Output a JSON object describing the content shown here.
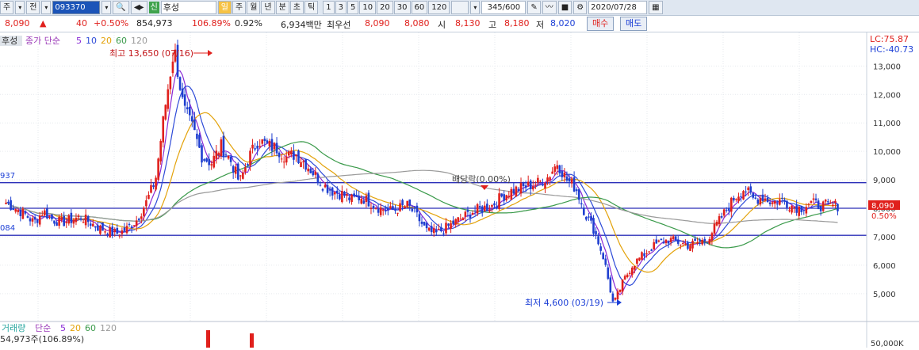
{
  "toolbar": {
    "market": "주",
    "mode": "전",
    "code": "093370",
    "name": "후성",
    "shin": "신",
    "periods": [
      "일",
      "주",
      "월",
      "년",
      "분",
      "초",
      "틱"
    ],
    "selected_period": "일",
    "intervals": [
      "1",
      "3",
      "5",
      "10",
      "20",
      "30",
      "60",
      "120"
    ],
    "count": "345/600",
    "date": "2020/07/28"
  },
  "quote": {
    "price": "8,090",
    "arrow": "▲",
    "change": "40",
    "change_pct": "+0.50%",
    "volume": "854,973",
    "vol_ratio": "106.89%",
    "turnover": "0.92%",
    "amount": "6,934백만",
    "best_label": "최우선",
    "best_ask": "8,090",
    "best_bid": "8,080",
    "open_label": "시",
    "open": "8,130",
    "high_label": "고",
    "high": "8,180",
    "low_label": "저",
    "low": "8,020",
    "buy_label": "매수",
    "sell_label": "매도"
  },
  "legend": {
    "name": "후성",
    "price_label": "종가 단순",
    "ma_periods": [
      "5",
      "10",
      "20",
      "60",
      "120"
    ],
    "ma_colors": [
      "#8a2bd6",
      "#2e4bd8",
      "#e3a20a",
      "#3a9a4a",
      "#9a9a9a"
    ],
    "lc": "LC:75.87",
    "hc": "HC:-40.73",
    "left_upper": "937",
    "left_lower": "084"
  },
  "volume_legend": {
    "label": "거래량",
    "type": "단순",
    "ma_periods": [
      "5",
      "20",
      "60",
      "120"
    ],
    "value": "54,973주(106.89%)",
    "axis_tick": "50,000K"
  },
  "annotations": {
    "high": "최고 13,650 (07/16)",
    "low": "최저 4,600 (03/19)",
    "dividend": "배당락(0.00%)",
    "last_price": "8,090",
    "last_pct": "0.50%"
  },
  "chart_data": {
    "type": "candlestick",
    "ylim": [
      4300,
      13900
    ],
    "yticks": [
      "13,000",
      "12,000",
      "11,000",
      "10,000",
      "9,000",
      "8,000",
      "7,000",
      "6,000",
      "5,000"
    ],
    "ytick_values": [
      13000,
      12000,
      11000,
      10000,
      9000,
      8000,
      7000,
      6000,
      5000
    ],
    "hlines": [
      8900,
      8000,
      7050
    ],
    "close_series": [
      8200,
      8000,
      7800,
      7500,
      7900,
      7600,
      7500,
      7600,
      7700,
      7500,
      7300,
      7200,
      7100,
      7300,
      7600,
      8200,
      9000,
      11500,
      13650,
      11500,
      10800,
      9800,
      9600,
      10200,
      9700,
      8900,
      9800,
      10400,
      10200,
      10100,
      9800,
      9900,
      9600,
      9200,
      8800,
      8600,
      8500,
      8300,
      8400,
      8200,
      8000,
      7900,
      8000,
      8100,
      7700,
      7200,
      7100,
      7300,
      7500,
      7700,
      7900,
      8000,
      8100,
      8400,
      8600,
      8700,
      8800,
      8900,
      9100,
      9600,
      9000,
      8700,
      7800,
      7200,
      6200,
      4600,
      5400,
      6000,
      6300,
      6600,
      6800,
      6900,
      6800,
      6700,
      6800,
      6900,
      7400,
      7900,
      8400,
      8700,
      8300,
      8400,
      8200,
      8300,
      8100,
      8000,
      8200,
      8100,
      8100,
      8090
    ],
    "series": [
      {
        "name": "5",
        "color": "#8a2bd6"
      },
      {
        "name": "10",
        "color": "#2e4bd8"
      },
      {
        "name": "20",
        "color": "#e3a20a"
      },
      {
        "name": "60",
        "color": "#3a9a4a"
      },
      {
        "name": "120",
        "color": "#9a9a9a"
      }
    ]
  }
}
